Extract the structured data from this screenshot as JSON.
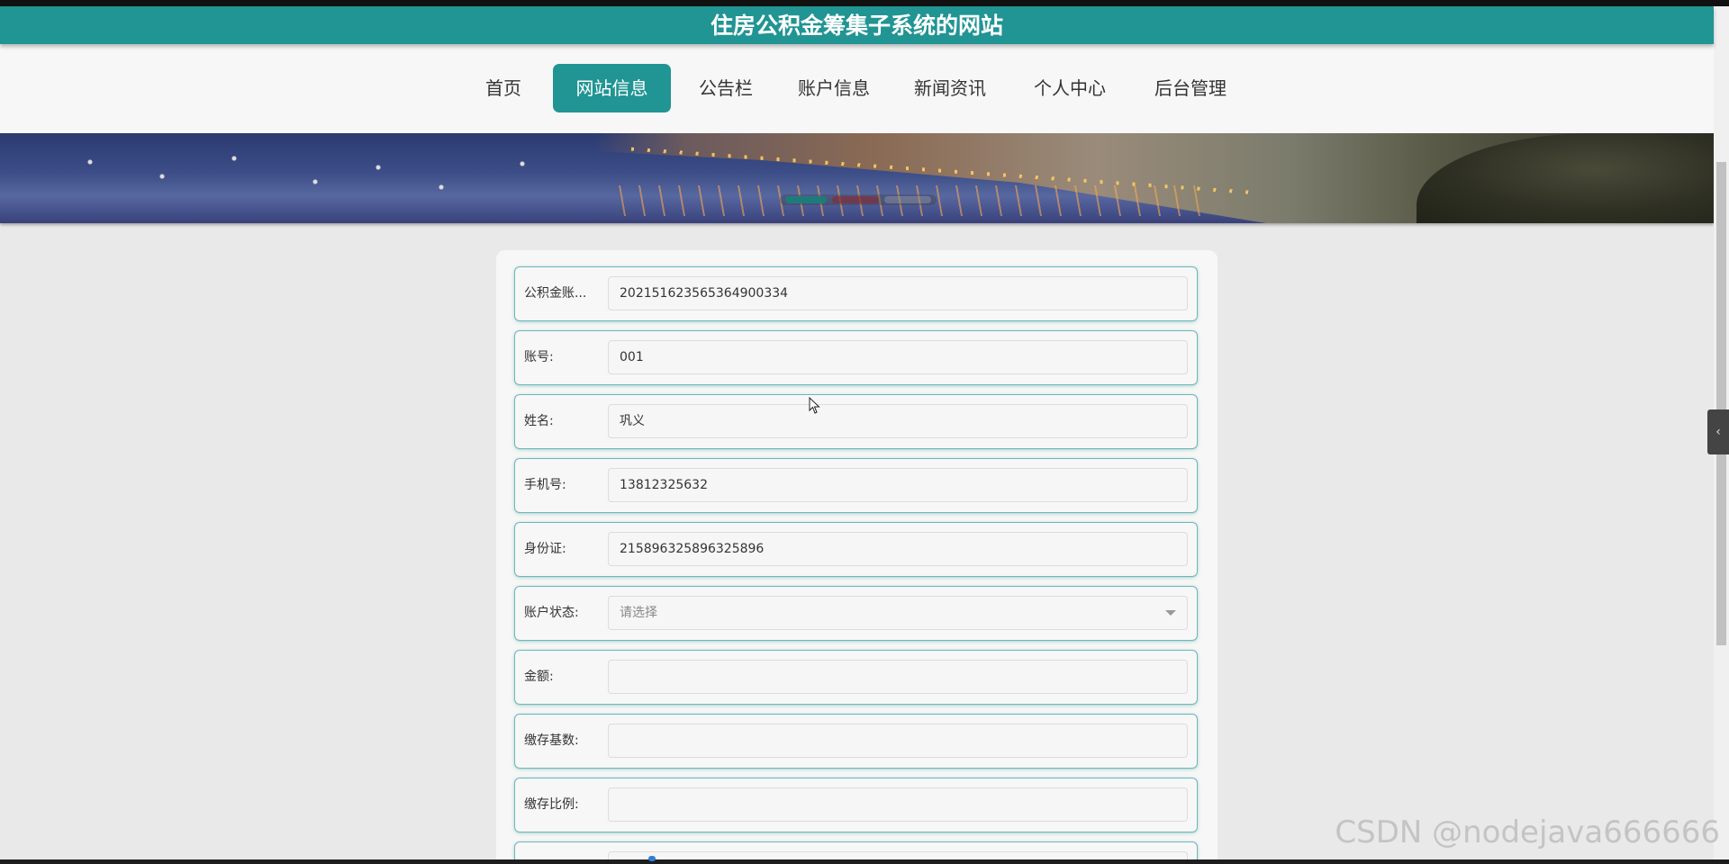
{
  "header": {
    "title": "住房公积金筹集子系统的网站",
    "accent_color": "#219494"
  },
  "nav": {
    "items": [
      {
        "label": "首页",
        "active": false
      },
      {
        "label": "网站信息",
        "active": true
      },
      {
        "label": "公告栏",
        "active": false
      },
      {
        "label": "账户信息",
        "active": false
      },
      {
        "label": "新闻资讯",
        "active": false
      },
      {
        "label": "个人中心",
        "active": false
      },
      {
        "label": "后台管理",
        "active": false
      }
    ]
  },
  "banner": {
    "icon": "harbor-night-photo"
  },
  "form": {
    "fields": [
      {
        "label": "公积金账...",
        "value": "202151623565364900334",
        "placeholder": ""
      },
      {
        "label": "账号:",
        "value": "001",
        "placeholder": ""
      },
      {
        "label": "姓名:",
        "value": "巩义",
        "placeholder": ""
      },
      {
        "label": "手机号:",
        "value": "13812325632",
        "placeholder": ""
      },
      {
        "label": "身份证:",
        "value": "215896325896325896",
        "placeholder": ""
      },
      {
        "label": "账户状态:",
        "value": "",
        "placeholder": "请选择",
        "type": "select"
      },
      {
        "label": "金额:",
        "value": "",
        "placeholder": ""
      },
      {
        "label": "缴存基数:",
        "value": "",
        "placeholder": ""
      },
      {
        "label": "缴存比例:",
        "value": "",
        "placeholder": ""
      }
    ]
  },
  "side_tab": {
    "icon": "chevron-left-icon",
    "glyph": "‹"
  },
  "watermark": {
    "text": "CSDN @nodejava666666"
  }
}
